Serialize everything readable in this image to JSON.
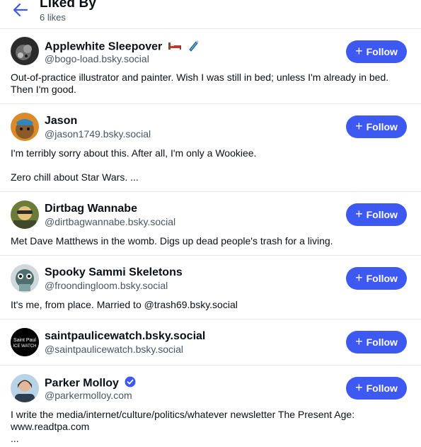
{
  "header": {
    "title": "Liked By",
    "subtitle": "6 likes"
  },
  "colors": {
    "accent": "#3e59f2",
    "muted": "#485563",
    "divider": "#e4e7ec"
  },
  "users": [
    {
      "name": "Applewhite Sleepover",
      "handle": "@bogo-load.bsky.social",
      "bio": "Out-of-practice illustrator and painter. Wish I was still in bed; unless I'm already in bed. Then I'm good.",
      "follow_label": "Follow",
      "name_icons": [
        "bed-emoji-icon",
        "paintbrush-emoji-icon"
      ]
    },
    {
      "name": "Jason",
      "handle": "@jason1749.bsky.social",
      "bio": "I'm terribly sorry about this. After all, I'm only a Wookiee.\n\nZero chill about Star Wars. ...",
      "follow_label": "Follow"
    },
    {
      "name": "Dirtbag Wannabe",
      "handle": "@dirtbagwannabe.bsky.social",
      "bio": "Met Dave Matthews in the womb. Digs up dead people's trash for a living.",
      "follow_label": "Follow"
    },
    {
      "name": "Spooky Sammi Skeletons",
      "handle": "@froondingloom.bsky.social",
      "bio": "It's me, from place. Married to @trash69.bsky.social",
      "follow_label": "Follow"
    },
    {
      "name": "saintpaulicewatch.bsky.social",
      "handle": "@saintpaulicewatch.bsky.social",
      "bio": "",
      "follow_label": "Follow",
      "avatar_text_1": "Saint Paul",
      "avatar_text_2": "ICE WATCH"
    },
    {
      "name": "Parker Molloy",
      "handle": "@parkermolloy.com",
      "bio": "I write the media/internet/culture/politics/whatever newsletter The Present Age: www.readtpa.com\n...",
      "follow_label": "Follow",
      "verified": true
    }
  ]
}
